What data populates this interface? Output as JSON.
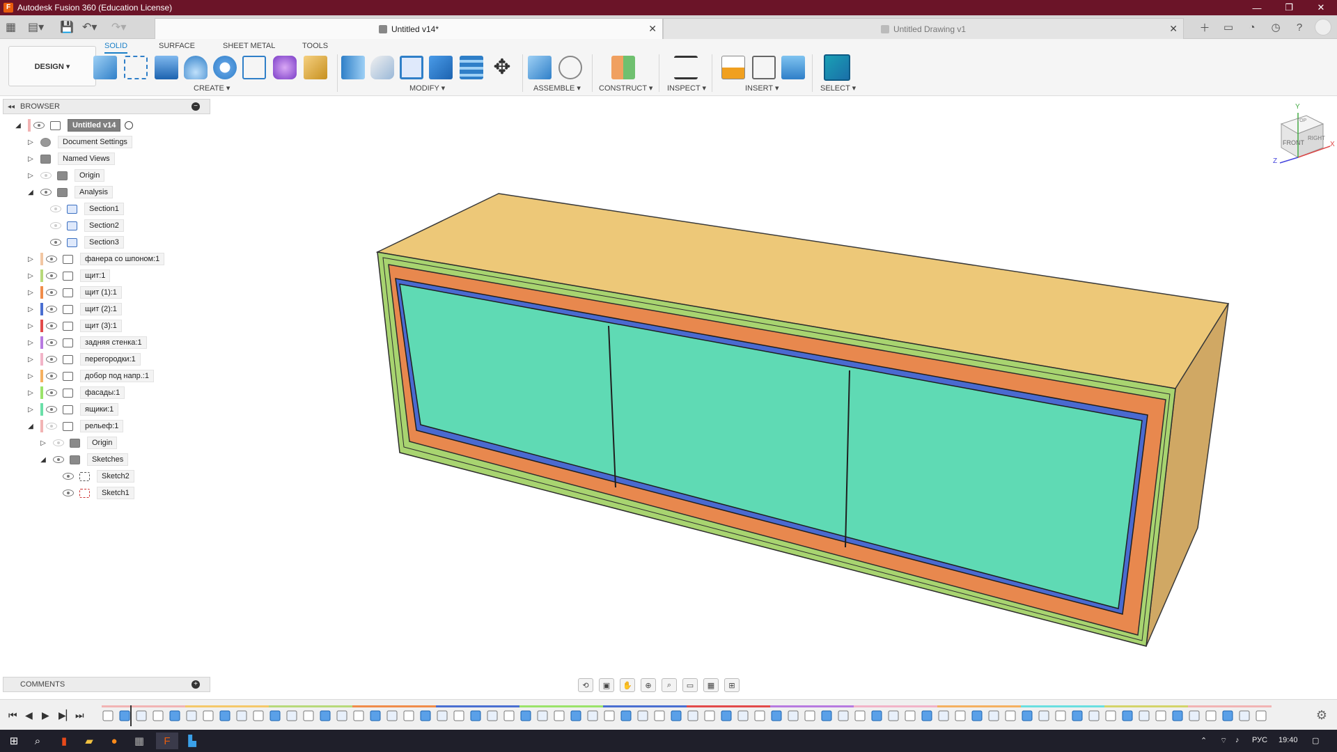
{
  "window": {
    "title": "Autodesk Fusion 360 (Education License)",
    "controls": [
      "—",
      "❐",
      "✕"
    ]
  },
  "tabs": {
    "active": "Untitled v14*",
    "inactive": "Untitled Drawing v1",
    "close": "✕"
  },
  "toolbar": {
    "design_label": "DESIGN ▾",
    "workspace_tabs": [
      "SOLID",
      "SURFACE",
      "SHEET METAL",
      "TOOLS"
    ],
    "groups": [
      "CREATE ▾",
      "MODIFY ▾",
      "ASSEMBLE ▾",
      "CONSTRUCT ▾",
      "INSPECT ▾",
      "INSERT ▾",
      "SELECT ▾"
    ]
  },
  "browser": {
    "header": "BROWSER",
    "root": "Untitled v14",
    "items": [
      {
        "label": "Document Settings"
      },
      {
        "label": "Named Views"
      },
      {
        "label": "Origin"
      },
      {
        "label": "Analysis"
      },
      {
        "label": "Section1"
      },
      {
        "label": "Section2"
      },
      {
        "label": "Section3"
      },
      {
        "label": "фанера со шпоном:1"
      },
      {
        "label": "щит:1"
      },
      {
        "label": "щит (1):1"
      },
      {
        "label": "щит (2):1"
      },
      {
        "label": "щит (3):1"
      },
      {
        "label": "задняя стенка:1"
      },
      {
        "label": "перегородки:1"
      },
      {
        "label": "добор под напр.:1"
      },
      {
        "label": "фасады:1"
      },
      {
        "label": "ящики:1"
      },
      {
        "label": "рельеф:1"
      },
      {
        "label": "Origin"
      },
      {
        "label": "Sketches"
      },
      {
        "label": "Sketch2"
      },
      {
        "label": "Sketch1"
      }
    ],
    "colors": {
      "phanera": "#f2c7a3",
      "shchit1": "#b7d97a",
      "shchit11": "#f08c4a",
      "shchit21": "#4a6fd1",
      "shchit31": "#e24a4a",
      "zadnyaya": "#b77ae0",
      "peregorodki": "#f2b4c8",
      "dobor": "#f5b060",
      "fasady": "#9be36a",
      "yashchiki": "#6adfa8",
      "relef": "#f2b4b4"
    }
  },
  "viewcube": {
    "top": "TOP",
    "front": "FRONT",
    "right": "RIGHT",
    "x": "X",
    "y": "Y",
    "z": "Z"
  },
  "comments": {
    "label": "COMMENTS"
  },
  "taskbar": {
    "lang": "РУС",
    "time": "19:40"
  }
}
